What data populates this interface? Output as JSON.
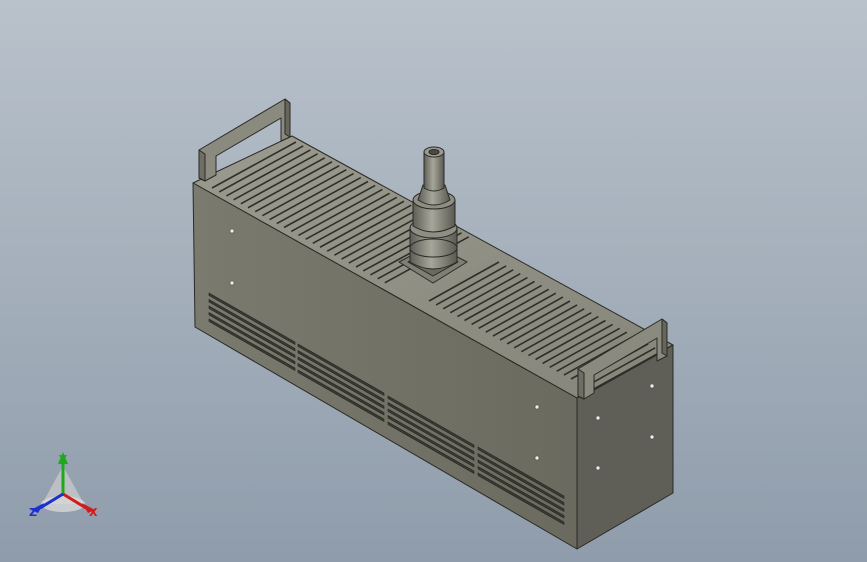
{
  "viewport": {
    "background_top": "#b9c2cb",
    "background_bottom": "#8f9cab"
  },
  "model": {
    "body_color": "#76766a",
    "front_face_color": "#6e6e62",
    "top_face_color": "#8c8c80",
    "end_face_color": "#5d5d55",
    "edge_color": "#2a2a26"
  },
  "triad": {
    "x_label": "X",
    "y_label": "Y",
    "z_label": "Z",
    "x_color": "#d01c1c",
    "y_color": "#1fa81f",
    "z_color": "#1c2fd0"
  }
}
